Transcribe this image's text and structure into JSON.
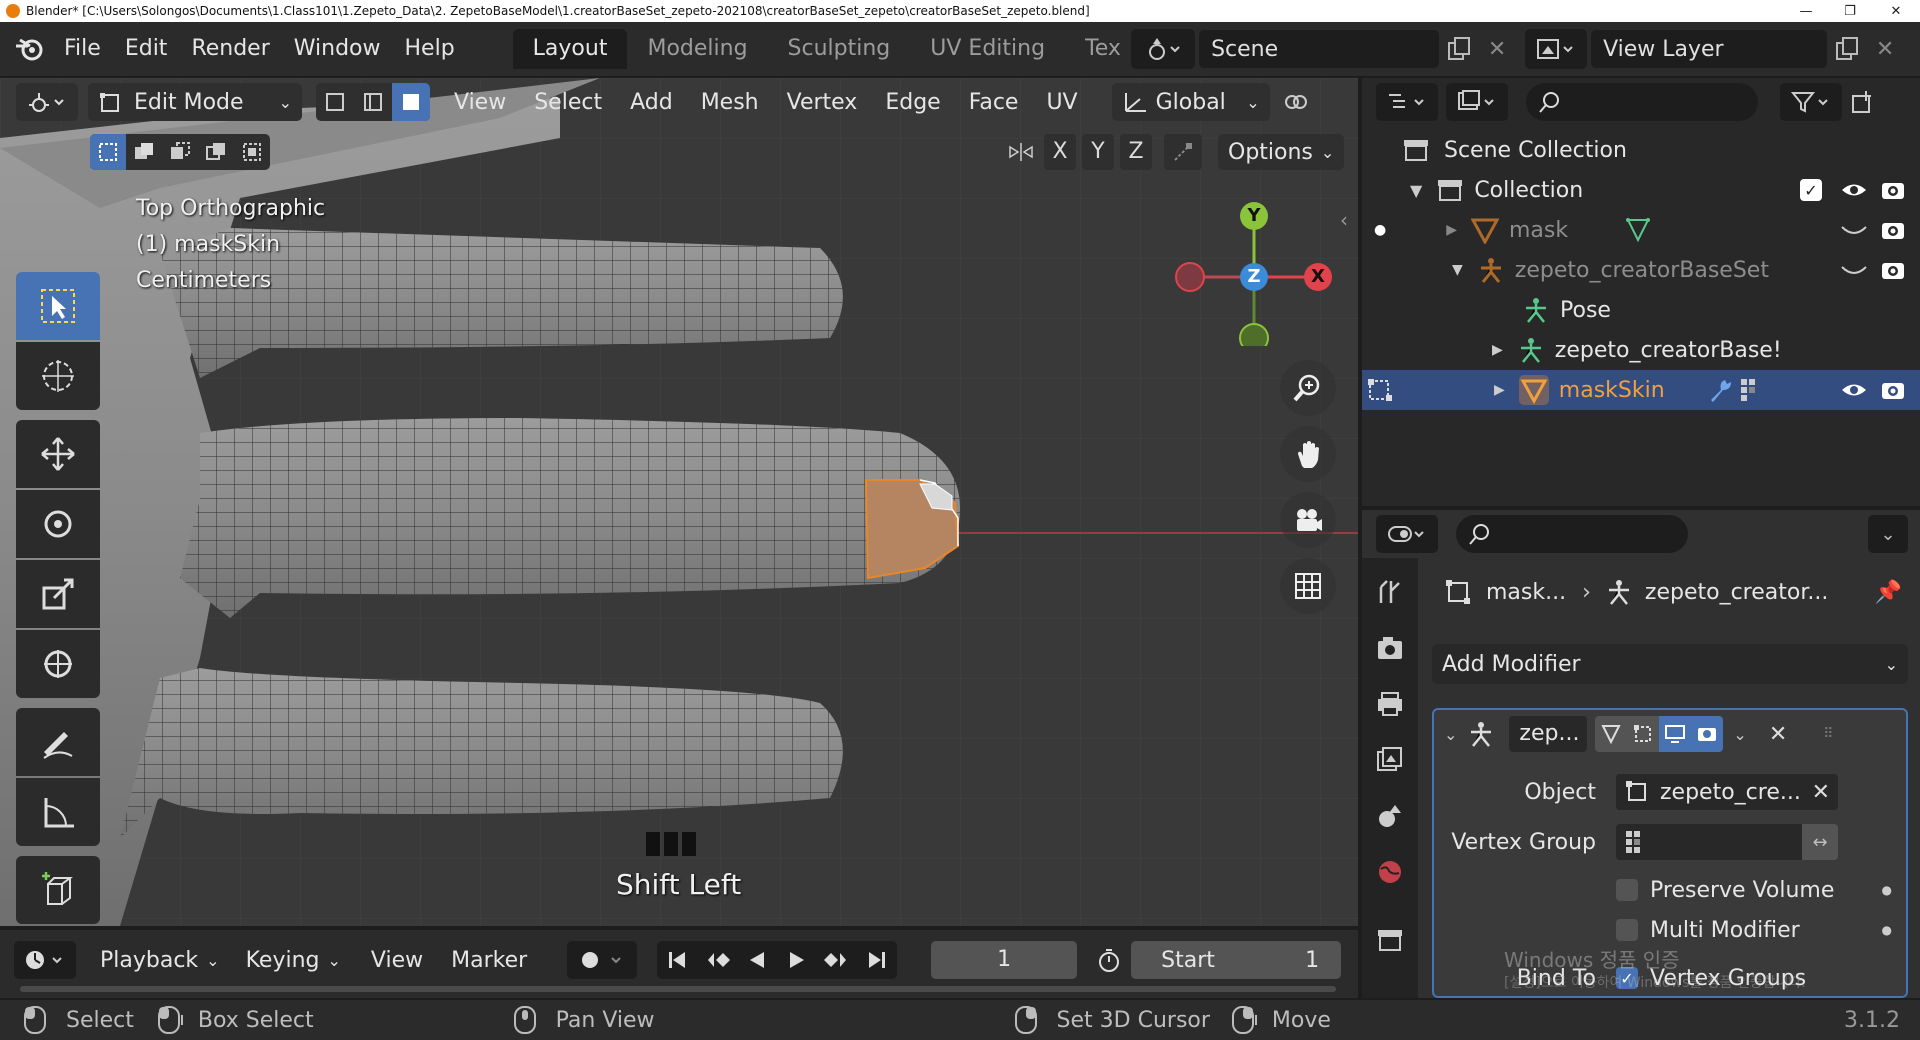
{
  "titlebar": {
    "text": "Blender* [C:\\Users\\Solongos\\Documents\\1.Class101\\1.Zepeto_Data\\2. ZepetoBaseModel\\1.creatorBaseSet_zepeto-202108\\creatorBaseSet_zepeto\\creatorBaseSet_zepeto.blend]",
    "minimize": "—",
    "maximize": "❐",
    "close": "✕"
  },
  "menu": [
    "File",
    "Edit",
    "Render",
    "Window",
    "Help"
  ],
  "workspaces": [
    "Layout",
    "Modeling",
    "Sculpting",
    "UV Editing",
    "Tex"
  ],
  "scene": {
    "label": "Scene"
  },
  "view_layer": {
    "label": "View Layer"
  },
  "viewport": {
    "mode": "Edit Mode",
    "menus": [
      "View",
      "Select",
      "Add",
      "Mesh",
      "Vertex",
      "Edge",
      "Face",
      "UV"
    ],
    "transform_orientation": "Global",
    "axes": [
      "X",
      "Y",
      "Z"
    ],
    "options_label": "Options",
    "overlay_lines": [
      "Top Orthographic",
      "(1) maskSkin",
      "Centimeters"
    ],
    "keystroke": "Shift Left",
    "gizmo": {
      "y": "Y",
      "z": "Z",
      "x": "X",
      "colors": {
        "x": "#e0434a",
        "y": "#8bc33b",
        "z": "#3b8bd8"
      }
    },
    "selection_color": "#e8862a"
  },
  "outliner": {
    "rows": [
      {
        "label": "Scene Collection"
      },
      {
        "label": "Collection"
      },
      {
        "label": "mask"
      },
      {
        "label": "zepeto_creatorBaseSet"
      },
      {
        "label": "Pose"
      },
      {
        "label": "zepeto_creatorBase!"
      },
      {
        "label": "maskSkin"
      }
    ]
  },
  "properties": {
    "breadcrumb": {
      "object": "mask...",
      "modifier_target": "zepeto_creator..."
    },
    "add_modifier": "Add Modifier",
    "modifier": {
      "name": "zep...",
      "object_label": "Object",
      "object_value": "zepeto_cre...",
      "vertex_group_label": "Vertex Group",
      "preserve_volume": "Preserve Volume",
      "multi_modifier": "Multi Modifier",
      "bind_to": "Bind To",
      "vertex_groups": "Vertex Groups"
    },
    "watermark_line1": "Windows 정품 인증",
    "watermark_line2": "[설정]으로 이동하여 Windows를 정품 인증합니다."
  },
  "timeline": {
    "menus": [
      "Playback",
      "Keying",
      "View",
      "Marker"
    ],
    "current_frame": "1",
    "start_label": "Start",
    "start_value": "1"
  },
  "status": {
    "items": [
      "Select",
      "Box Select",
      "Pan View",
      "Set 3D Cursor",
      "Move"
    ],
    "version": "3.1.2"
  }
}
